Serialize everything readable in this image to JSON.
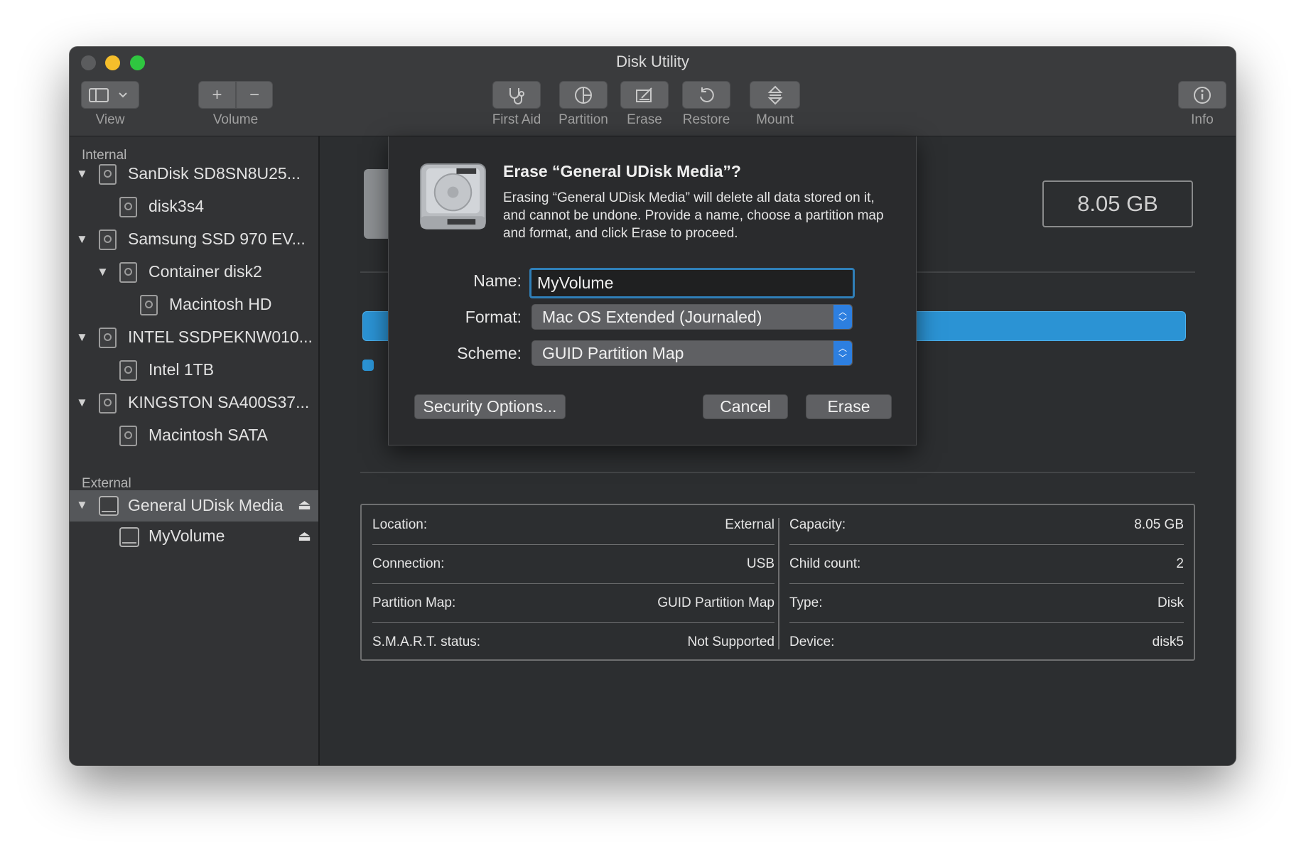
{
  "window": {
    "title": "Disk Utility"
  },
  "toolbar": {
    "view_label": "View",
    "volume_label": "Volume",
    "volume_add": "+",
    "volume_remove": "−",
    "first_aid_label": "First Aid",
    "partition_label": "Partition",
    "erase_label": "Erase",
    "restore_label": "Restore",
    "mount_label": "Mount",
    "info_label": "Info"
  },
  "sidebar": {
    "internal_header": "Internal",
    "internal_items": [
      {
        "label": "SanDisk SD8SN8U25...",
        "level": 0
      },
      {
        "label": "disk3s4",
        "level": 1
      },
      {
        "label": "Samsung SSD 970 EV...",
        "level": 0
      },
      {
        "label": "Container disk2",
        "level": 1
      },
      {
        "label": "Macintosh HD",
        "level": 2
      },
      {
        "label": "INTEL SSDPEKNW010...",
        "level": 0
      },
      {
        "label": "Intel 1TB",
        "level": 1
      },
      {
        "label": "KINGSTON SA400S37...",
        "level": 0
      },
      {
        "label": "Macintosh SATA",
        "level": 1
      }
    ],
    "external_header": "External",
    "external_items": [
      {
        "label": "General UDisk Media",
        "level": 0,
        "selected": true
      },
      {
        "label": "MyVolume",
        "level": 1
      }
    ]
  },
  "main": {
    "capacity_display": "8.05 GB",
    "usage_color": "#2b93d4",
    "info": [
      {
        "key": "Location:",
        "value": "External"
      },
      {
        "key": "Capacity:",
        "value": "8.05 GB"
      },
      {
        "key": "Connection:",
        "value": "USB"
      },
      {
        "key": "Child count:",
        "value": "2"
      },
      {
        "key": "Partition Map:",
        "value": "GUID Partition Map"
      },
      {
        "key": "Type:",
        "value": "Disk"
      },
      {
        "key": "S.M.A.R.T. status:",
        "value": "Not Supported"
      },
      {
        "key": "Device:",
        "value": "disk5"
      }
    ]
  },
  "dialog": {
    "title": "Erase “General UDisk Media”?",
    "message": "Erasing “General UDisk Media” will delete all data stored on it, and cannot be undone. Provide a name, choose a partition map and format, and click Erase to proceed.",
    "name_label": "Name:",
    "name_value": "MyVolume",
    "format_label": "Format:",
    "format_value": "Mac OS Extended (Journaled)",
    "scheme_label": "Scheme:",
    "scheme_value": "GUID Partition Map",
    "security_button": "Security Options...",
    "cancel_button": "Cancel",
    "erase_button": "Erase"
  },
  "colors": {
    "accent": "#2d7fe0",
    "focus_ring": "#2f7fb8"
  }
}
